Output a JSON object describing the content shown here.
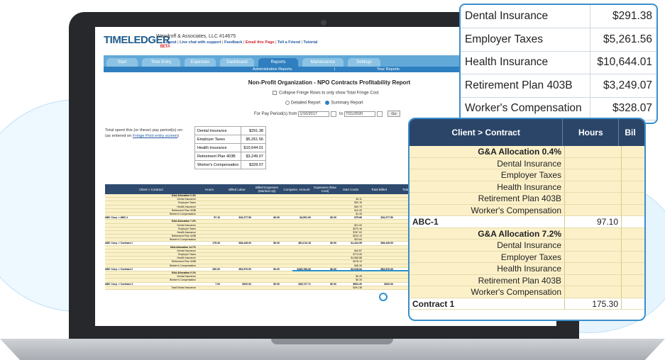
{
  "app": {
    "logo_text": "TIMELEDGER",
    "logo_beta": "BETA",
    "company": "Wendroff & Associates, LLC #14675",
    "links": {
      "logout": "Logout",
      "live_chat": "Live chat with support",
      "feedback": "Feedback",
      "email_page": "Email this Page",
      "tell_friend": "Tell a Friend",
      "tutorial": "Tutorial"
    }
  },
  "nav": {
    "tabs": [
      "Start",
      "Time Entry",
      "Expenses",
      "Dashboard",
      "Reports",
      "Maintenance",
      "Settings"
    ],
    "active_tab": "Reports",
    "sub_admin": "Administrative Reports",
    "sub_your": "Your Reports"
  },
  "report": {
    "title": "Non-Profit Organization - NPO Contracts Profitability Report",
    "collapse_label": "Collapse Fringe Rows to only show Total Fringe Cost",
    "detailed_label": "Detailed Report",
    "summary_label": "Summary Report",
    "period_label": "For Pay Period(s) from",
    "from_date": "1/16/2017",
    "to_label": "to",
    "to_date": "7/31/2020",
    "go_label": "Go",
    "spent_text": "Total spent this (or these) pay period(s) on:",
    "spent_sub": "(as entered on ",
    "spent_link": "Fringe Pool entry screen",
    "spent_end": ")"
  },
  "fringe": [
    {
      "name": "Dental Insurance",
      "amount": "$291.38"
    },
    {
      "name": "Employer Taxes",
      "amount": "$5,261.56"
    },
    {
      "name": "Health Insurance",
      "amount": "$10,644.01"
    },
    {
      "name": "Retirement Plan 403B",
      "amount": "$3,249.07"
    },
    {
      "name": "Worker's Compensation",
      "amount": "$328.07"
    }
  ],
  "big_table": {
    "headers": [
      "Client > Contract",
      "Hours",
      "Billed Labor",
      "Billed Expenses (Marked Up)",
      "Compens. Amount",
      "Expenses (Raw Cost)",
      "G&A Costs",
      "Total Billed",
      "Total Costs",
      "Gro"
    ],
    "rows": [
      {
        "type": "sub",
        "label": "G&A Allocation 0.4%",
        "bold": true,
        "ga": ""
      },
      {
        "type": "sub",
        "label": "Dental Insurance",
        "ga": "$1.11"
      },
      {
        "type": "sub",
        "label": "Employer Taxes",
        "ga": "$20.15"
      },
      {
        "type": "sub",
        "label": "Health Insurance",
        "ga": "$40.73"
      },
      {
        "type": "sub",
        "label": "Retirement Plan 403B",
        "ga": "$12.43"
      },
      {
        "type": "sub",
        "label": "Worker's Compensation",
        "ga": "$1.26"
      },
      {
        "type": "main",
        "label": "ABC Corp. > ABC-1",
        "hours": "97.10",
        "billed": "$10,277.50",
        "exp": "$0.00",
        "comp": "$4,501.00",
        "raw": "$0.00",
        "ga": "$75.66",
        "tb": "$10,277.50",
        "tc": "$4,371.34"
      },
      {
        "type": "sub",
        "label": "G&A Allocation 7.2%",
        "bold": true,
        "ga": ""
      },
      {
        "type": "sub",
        "label": "Dental Insurance",
        "ga": "$21.00"
      },
      {
        "type": "sub",
        "label": "Employer Taxes",
        "ga": "$379.16"
      },
      {
        "type": "sub",
        "label": "Health Insurance",
        "ga": "$767.02"
      },
      {
        "type": "sub",
        "label": "Retirement Plan 403B",
        "ga": "$234.13"
      },
      {
        "type": "sub",
        "label": "Worker's Compensation",
        "ga": "$23.64"
      },
      {
        "type": "main",
        "label": "ABC Corp. > Contract 1",
        "hours": "175.30",
        "billed": "$36,445.00",
        "exp": "$0.00",
        "comp": "$61,013.18",
        "raw": "$0.00",
        "ga": "$1,424.95",
        "tb": "$36,445.00",
        "tc": "$62,438.13"
      },
      {
        "type": "sub",
        "label": "G&A Allocation 14.7%",
        "bold": true,
        "ga": ""
      },
      {
        "type": "sub",
        "label": "Dental Insurance",
        "ga": "$42.87"
      },
      {
        "type": "sub",
        "label": "Employer Taxes",
        "ga": "$774.05"
      },
      {
        "type": "sub",
        "label": "Health Insurance",
        "ga": "$1,565.88"
      },
      {
        "type": "sub",
        "label": "Retirement Plan 403B",
        "ga": "$478.13"
      },
      {
        "type": "sub",
        "label": "Worker's Compensation",
        "ga": "$48.26"
      },
      {
        "type": "main",
        "label": "ABC Corp. > Contract 2",
        "hours": "260.00",
        "billed": "$52,570.00",
        "exp": "$0.00",
        "comp": "$165,780.00",
        "raw": "$0.00",
        "ga": "$2,915.94",
        "tb": "$52,570.00",
        "tc": "$168,696.87"
      },
      {
        "type": "sub",
        "label": "G&A Allocation 0.1%",
        "bold": true,
        "ga": ""
      },
      {
        "type": "sub",
        "label": "Dental Insurance",
        "ga": "$0.25"
      },
      {
        "type": "sub",
        "label": "Worker's Compensation",
        "ga": "$0.30"
      },
      {
        "type": "main",
        "label": "ABC Corp. > Contract 4",
        "hours": "7.00",
        "billed": "$200.00",
        "exp": "$0.00",
        "comp": "$28,727.71",
        "raw": "$0.00",
        "ga": "$503.20",
        "tb": "$200.00",
        "tc": "$29,230.91",
        "gross": "($29,030.91)",
        "red": "-14,515.4%",
        "c1": "0.00",
        "c2": "0.0%",
        "c3": "$0.00",
        "c4": "0.0%"
      },
      {
        "type": "total",
        "label": "Total Dental Insurance",
        "ga": "$291.38"
      }
    ]
  },
  "callout1": [
    {
      "name": "Dental Insurance",
      "amount": "$291.38"
    },
    {
      "name": "Employer Taxes",
      "amount": "$5,261.56"
    },
    {
      "name": "Health Insurance",
      "amount": "$10,644.01"
    },
    {
      "name": "Retirement Plan 403B",
      "amount": "$3,249.07"
    },
    {
      "name": "Worker's Compensation",
      "amount": "$328.07"
    }
  ],
  "callout2": {
    "head_client": "Client > Contract",
    "head_hours": "Hours",
    "head_cut": "Bil",
    "rows": [
      {
        "type": "sub",
        "label": "G&A Allocation 0.4%",
        "bold": true
      },
      {
        "type": "sub",
        "label": "Dental Insurance"
      },
      {
        "type": "sub",
        "label": "Employer Taxes"
      },
      {
        "type": "sub",
        "label": "Health Insurance"
      },
      {
        "type": "sub",
        "label": "Retirement Plan 403B"
      },
      {
        "type": "sub",
        "label": "Worker's Compensation"
      },
      {
        "type": "main",
        "label": "ABC-1",
        "hours": "97.10"
      },
      {
        "type": "sub",
        "label": "G&A Allocation 7.2%",
        "bold": true
      },
      {
        "type": "sub",
        "label": "Dental Insurance"
      },
      {
        "type": "sub",
        "label": "Employer Taxes"
      },
      {
        "type": "sub",
        "label": "Health Insurance"
      },
      {
        "type": "sub",
        "label": "Retirement Plan 403B"
      },
      {
        "type": "sub",
        "label": "Worker's Compensation"
      },
      {
        "type": "main",
        "label": "Contract 1",
        "hours": "175.30"
      }
    ]
  },
  "colors": {
    "nav": "#62a9d8",
    "nav_active": "#2f7fc0",
    "table_head": "#2e4a6e",
    "fringe_row": "#fbf1c9",
    "accent": "#3a8fcb",
    "negative": "#e0262a"
  }
}
